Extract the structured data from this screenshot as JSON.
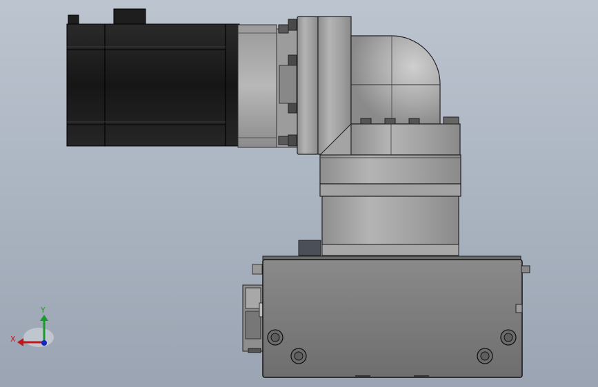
{
  "viewport": {
    "background_top": "#bcc4cf",
    "background_bottom": "#9aa4b2"
  },
  "triad": {
    "x_label": "X",
    "y_label": "Y",
    "x_color": "#c0161c",
    "y_color": "#1a9a2a",
    "z_color": "#1428c8"
  },
  "model": {
    "icon": "cad-assembly-icon",
    "motor_color": "#1c1c1c",
    "metal_color": "#a6a6a6",
    "base_color": "#7d7d7d"
  }
}
